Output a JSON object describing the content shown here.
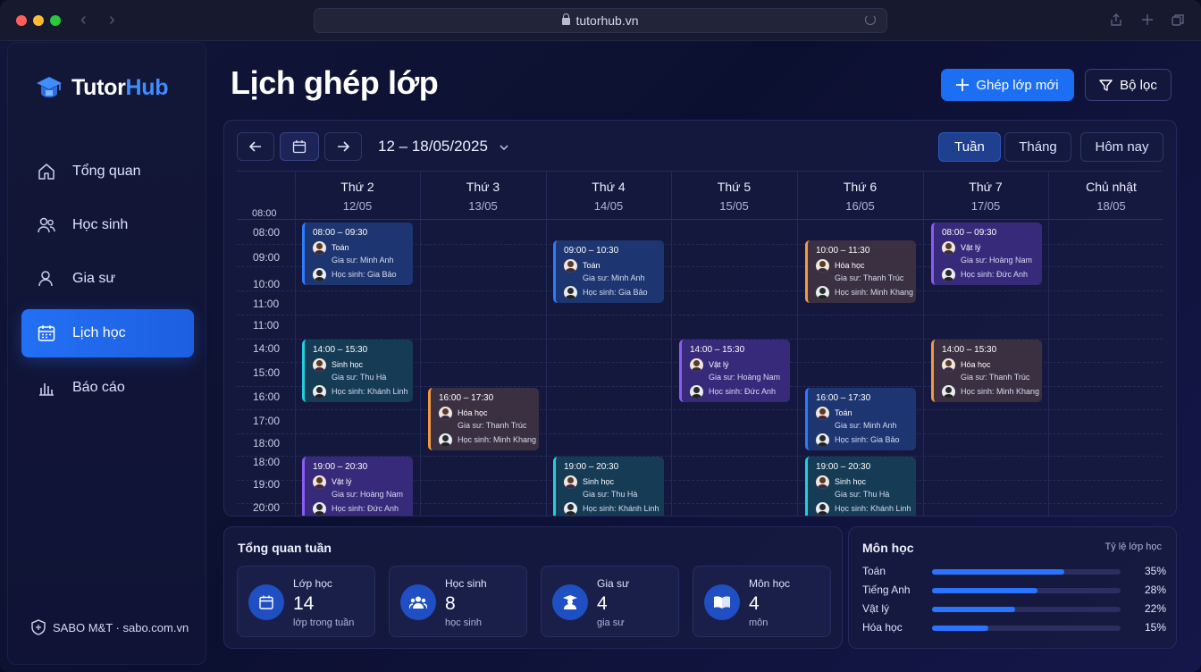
{
  "browser": {
    "url": "tutorhub.vn"
  },
  "brand": {
    "name_part1": "Tutor",
    "name_part2": "Hub"
  },
  "sidebar": {
    "items": [
      {
        "label": "Tổng quan",
        "icon": "home-icon"
      },
      {
        "label": "Học sinh",
        "icon": "students-icon"
      },
      {
        "label": "Gia sư",
        "icon": "tutor-icon"
      },
      {
        "label": "Lịch học",
        "icon": "calendar-icon",
        "active": true
      },
      {
        "label": "Báo cáo",
        "icon": "chart-icon"
      }
    ],
    "footer": "SABO M&T · sabo.com.vn"
  },
  "header": {
    "title": "Lịch ghép lớp",
    "primary_button": "Ghép lớp mới",
    "filter_button": "Bộ lọc"
  },
  "calendar": {
    "range": "12 – 18/05/2025",
    "views": [
      "Tuần",
      "Tháng",
      "Hôm nay"
    ],
    "active_view": "Tuần",
    "days": [
      {
        "name": "Thứ 2",
        "date": "12/05"
      },
      {
        "name": "Thứ 3",
        "date": "13/05"
      },
      {
        "name": "Thứ 4",
        "date": "14/05"
      },
      {
        "name": "Thứ 5",
        "date": "15/05"
      },
      {
        "name": "Thứ 6",
        "date": "16/05"
      },
      {
        "name": "Thứ 7",
        "date": "17/05"
      },
      {
        "name": "Chủ nhật",
        "date": "18/05"
      }
    ],
    "time_labels": [
      "08:00",
      "08:00",
      "09:00",
      "10:00",
      "11:00",
      "11:00",
      "14:00",
      "15:00",
      "16:00",
      "17:00",
      "18:00",
      "18:00",
      "19:00",
      "20:00"
    ],
    "events": [
      {
        "day": 0,
        "row": 0,
        "color": "blue",
        "time": "08:00 – 09:30",
        "subject": "Toán",
        "tutor": "Gia sư: Minh Anh",
        "student": "Học sinh: Gia Bảo"
      },
      {
        "day": 0,
        "row": 2,
        "color": "teal",
        "time": "14:00 – 15:30",
        "subject": "Sinh học",
        "tutor": "Gia sư: Thu Hà",
        "student": "Học sinh: Khánh Linh"
      },
      {
        "day": 0,
        "row": 4,
        "color": "purple",
        "time": "19:00 – 20:30",
        "subject": "Vật lý",
        "tutor": "Gia sư: Hoàng Nam",
        "student": "Học sinh: Đức Anh"
      },
      {
        "day": 1,
        "row": 3,
        "color": "orange",
        "time": "16:00 – 17:30",
        "subject": "Hóa học",
        "tutor": "Gia sư: Thanh Trúc",
        "student": "Học sinh: Minh Khang"
      },
      {
        "day": 2,
        "row": 1,
        "color": "blue",
        "time": "09:00 – 10:30",
        "subject": "Toán",
        "tutor": "Gia sư: Minh Anh",
        "student": "Học sinh: Gia Bảo"
      },
      {
        "day": 2,
        "row": 4,
        "color": "teal",
        "time": "19:00 – 20:30",
        "subject": "Sinh học",
        "tutor": "Gia sư: Thu Hà",
        "student": "Học sinh: Khánh Linh"
      },
      {
        "day": 3,
        "row": 2,
        "color": "purple",
        "time": "14:00 – 15:30",
        "subject": "Vật lý",
        "tutor": "Gia sư: Hoàng Nam",
        "student": "Học sinh: Đức Anh"
      },
      {
        "day": 4,
        "row": 1,
        "color": "orange",
        "time": "10:00 – 11:30",
        "subject": "Hóa học",
        "tutor": "Gia sư: Thanh Trúc",
        "student": "Học sinh: Minh Khang"
      },
      {
        "day": 4,
        "row": 3,
        "color": "blue",
        "time": "16:00 – 17:30",
        "subject": "Toán",
        "tutor": "Gia sư: Minh Anh",
        "student": "Học sinh: Gia Bảo"
      },
      {
        "day": 4,
        "row": 4,
        "color": "teal",
        "time": "19:00 – 20:30",
        "subject": "Sinh học",
        "tutor": "Gia sư: Thu Hà",
        "student": "Học sinh: Khánh Linh"
      },
      {
        "day": 5,
        "row": 0,
        "color": "purple",
        "time": "08:00 – 09:30",
        "subject": "Vật lý",
        "tutor": "Gia sư: Hoàng Nam",
        "student": "Học sinh: Đức Anh"
      },
      {
        "day": 5,
        "row": 2,
        "color": "orange",
        "time": "14:00 – 15:30",
        "subject": "Hóa học",
        "tutor": "Gia sư: Thanh Trúc",
        "student": "Học sinh: Minh Khang"
      }
    ]
  },
  "week_summary": {
    "title": "Tổng quan tuần",
    "stats": [
      {
        "label": "Lớp học",
        "value": "14",
        "sub": "lớp trong tuần",
        "icon": "calendar-icon"
      },
      {
        "label": "Học sinh",
        "value": "8",
        "sub": "học sinh",
        "icon": "group-icon"
      },
      {
        "label": "Gia sư",
        "value": "4",
        "sub": "gia sư",
        "icon": "tutor-icon"
      },
      {
        "label": "Môn học",
        "value": "4",
        "sub": "môn",
        "icon": "book-icon"
      }
    ]
  },
  "subjects": {
    "title": "Môn học",
    "subtitle": "Tỷ lệ lớp học",
    "items": [
      {
        "name": "Toán",
        "pct": "35%",
        "value": 35
      },
      {
        "name": "Tiếng Anh",
        "pct": "28%",
        "value": 28
      },
      {
        "name": "Vật lý",
        "pct": "22%",
        "value": 22
      },
      {
        "name": "Hóa học",
        "pct": "15%",
        "value": 15
      }
    ]
  },
  "colors": {
    "accent": "#1c6ff3",
    "blue": "#2f7bff",
    "teal": "#1fd0e0",
    "purple": "#8b5cf6",
    "orange": "#f59a3c"
  }
}
